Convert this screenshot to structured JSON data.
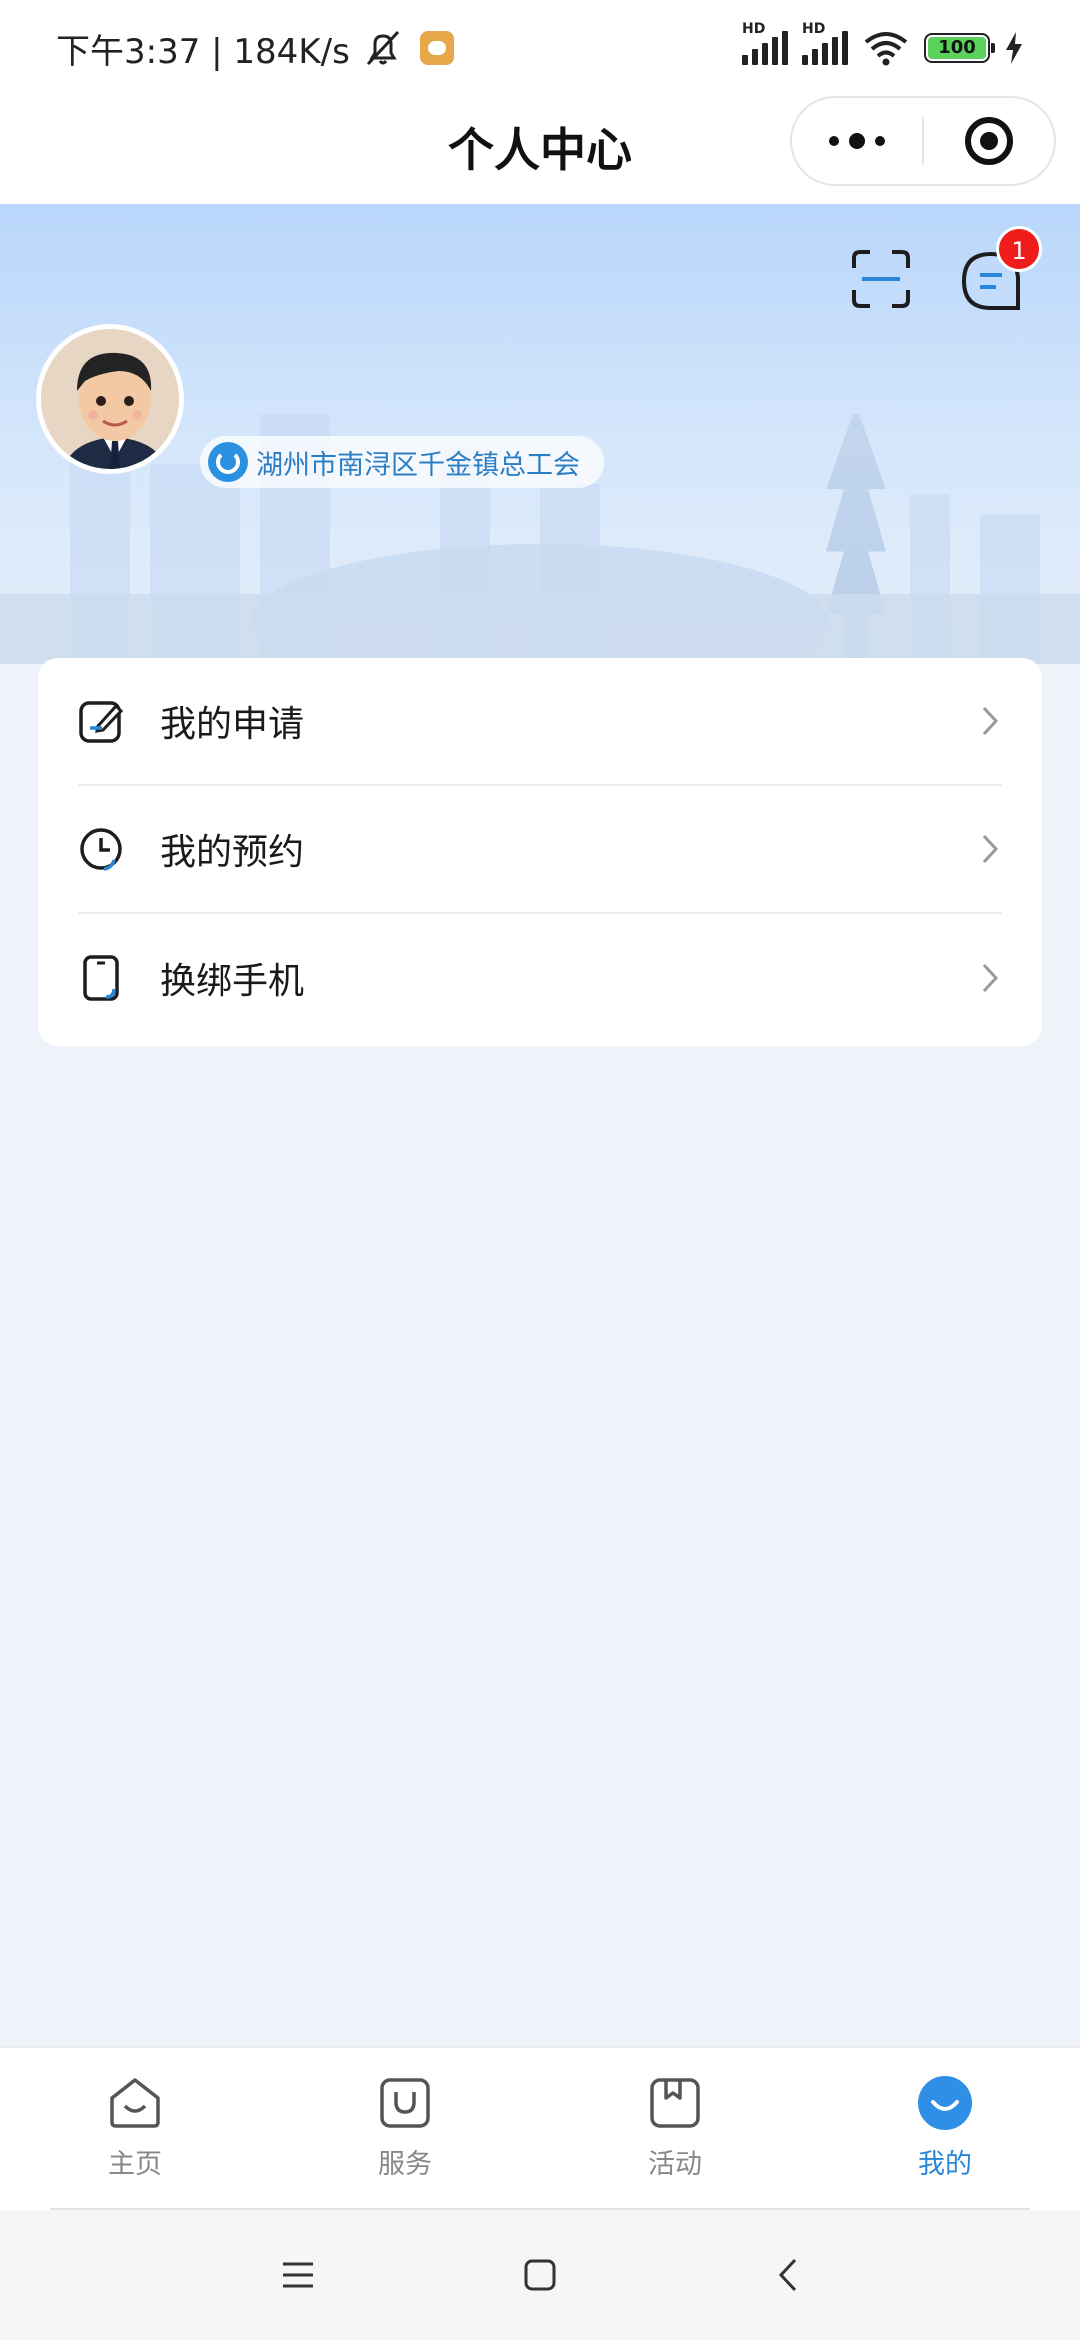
{
  "status_bar": {
    "time_speed": "下午3:37 | 184K/s",
    "network_1": "HD",
    "network_2": "HD",
    "battery": "100"
  },
  "nav": {
    "title": "个人中心"
  },
  "header": {
    "notification_count": "1",
    "org_name": "湖州市南浔区千金镇总工会"
  },
  "menu": {
    "items": [
      {
        "label": "我的申请",
        "icon": "edit-icon"
      },
      {
        "label": "我的预约",
        "icon": "clock-icon"
      },
      {
        "label": "换绑手机",
        "icon": "phone-icon"
      }
    ]
  },
  "tabbar": {
    "tabs": [
      {
        "label": "主页",
        "icon": "home-icon"
      },
      {
        "label": "服务",
        "icon": "bag-icon"
      },
      {
        "label": "活动",
        "icon": "bookmark-icon"
      },
      {
        "label": "我的",
        "icon": "profile-icon",
        "active": true
      }
    ]
  },
  "colors": {
    "accent": "#2a86d8",
    "badge": "#f01c1c",
    "background": "#eef3fa"
  }
}
